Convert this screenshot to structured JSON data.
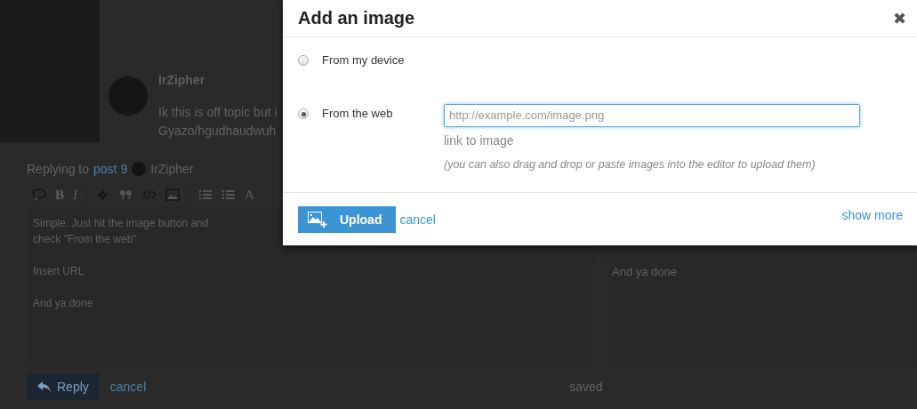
{
  "post": {
    "author": "IrZipher",
    "lines": [
      "Ik this is off topic but i",
      "Gyazo/hgudhaudwuh"
    ]
  },
  "composer": {
    "replying_label": "Replying to",
    "post_link": "post 9",
    "reply_user": "IrZipher",
    "toolbar": [
      {
        "kind": "bubble"
      },
      {
        "kind": "bold-letter",
        "label": "B"
      },
      {
        "kind": "italic-letter",
        "label": "I"
      },
      {
        "kind": "separator"
      },
      {
        "kind": "link"
      },
      {
        "kind": "quote"
      },
      {
        "kind": "code"
      },
      {
        "kind": "image"
      },
      {
        "kind": "separator"
      },
      {
        "kind": "ordered-list"
      },
      {
        "kind": "bullet-list"
      },
      {
        "kind": "letter",
        "label": "A"
      }
    ],
    "editor_lines": [
      "Simple. Just hit the image button and",
      "check \"From the web\"",
      "Insert URL",
      "And ya done"
    ],
    "preview_lines": [
      "And ya done"
    ],
    "reply_button": "Reply",
    "cancel": "cancel",
    "status": "saved"
  },
  "modal": {
    "title": "Add an image",
    "close": "✖",
    "options": [
      {
        "label": "From my device",
        "selected": false
      },
      {
        "label": "From the web",
        "selected": true
      }
    ],
    "url_field": {
      "placeholder": "http://example.com/image.png"
    },
    "field_label": "link to image",
    "hint": "(you can also drag and drop or paste images into the editor to upload them)",
    "upload_button": "Upload",
    "cancel": "cancel",
    "show_more": "show more"
  }
}
